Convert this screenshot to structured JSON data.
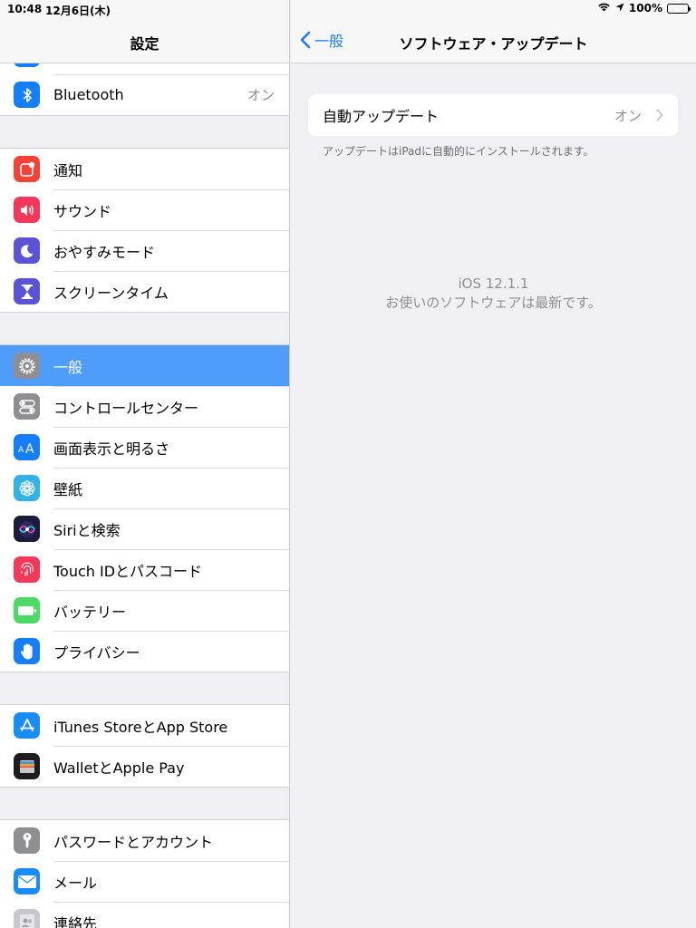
{
  "status": {
    "time": "10:48",
    "date": "12月6日(木)",
    "battery": "100%"
  },
  "sidebar": {
    "title": "設定",
    "groups": [
      {
        "items": [
          {
            "label": "Bluetooth",
            "value": "オン",
            "icon": "bluetooth-icon",
            "color": "#147efb"
          }
        ]
      },
      {
        "items": [
          {
            "label": "通知",
            "icon": "notification-icon",
            "color": "#f44336"
          },
          {
            "label": "サウンド",
            "icon": "speaker-icon",
            "color": "#f4385a"
          },
          {
            "label": "おやすみモード",
            "icon": "moon-icon",
            "color": "#5b53d6"
          },
          {
            "label": "スクリーンタイム",
            "icon": "hourglass-icon",
            "color": "#5b53d6"
          }
        ]
      },
      {
        "items": [
          {
            "label": "一般",
            "icon": "gear-icon",
            "color": "#8e8e93",
            "selected": true
          },
          {
            "label": "コントロールセンター",
            "icon": "toggles-icon",
            "color": "#8e8e93"
          },
          {
            "label": "画面表示と明るさ",
            "icon": "text-size-icon",
            "color": "#147efb"
          },
          {
            "label": "壁紙",
            "icon": "flower-icon",
            "color": "#33b2e6"
          },
          {
            "label": "Siriと検索",
            "icon": "siri-icon",
            "color": "#1c1c3a"
          },
          {
            "label": "Touch IDとパスコード",
            "icon": "fingerprint-icon",
            "color": "#f4385a"
          },
          {
            "label": "バッテリー",
            "icon": "battery-icon",
            "color": "#4cd964"
          },
          {
            "label": "プライバシー",
            "icon": "hand-icon",
            "color": "#147efb"
          }
        ]
      },
      {
        "items": [
          {
            "label": "iTunes StoreとApp Store",
            "icon": "app-store-icon",
            "color": "#1a8cf7"
          },
          {
            "label": "WalletとApple Pay",
            "icon": "wallet-icon",
            "color": "#1c1c1e"
          }
        ]
      },
      {
        "items": [
          {
            "label": "パスワードとアカウント",
            "icon": "key-icon",
            "color": "#8e8e93"
          },
          {
            "label": "メール",
            "icon": "mail-icon",
            "color": "#1a8cf7"
          },
          {
            "label": "連絡先",
            "icon": "contacts-icon",
            "color": "#c7c7cc"
          }
        ]
      }
    ]
  },
  "detail": {
    "back_label": "一般",
    "title": "ソフトウェア・アップデート",
    "auto_update": {
      "label": "自動アップデート",
      "value": "オン"
    },
    "footnote": "アップデートはiPadに自動的にインストールされます。",
    "version": "iOS 12.1.1",
    "version_message": "お使いのソフトウェアは最新です。"
  },
  "colors": {
    "accent": "#1a7cf5",
    "selected_row": "#4f9dfb"
  }
}
